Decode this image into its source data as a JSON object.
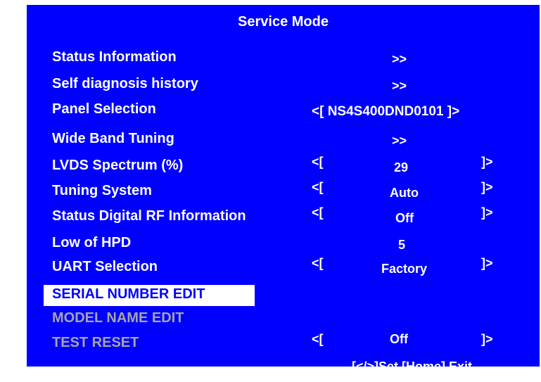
{
  "title": "Service Mode",
  "items": [
    {
      "label": "Status Information",
      "value": ">>"
    },
    {
      "label": "Self diagnosis history",
      "value": ">>"
    },
    {
      "label": "Panel Selection",
      "value": "<[ NS4S400DND0101 ]>"
    },
    {
      "label": "Wide Band Tuning",
      "value": ">>"
    },
    {
      "label": "LVDS Spectrum (%)",
      "bracket_left": "<[",
      "value": "29",
      "bracket_right": "]>"
    },
    {
      "label": "Tuning System",
      "bracket_left": "<[",
      "value": "Auto",
      "bracket_right": "]>"
    },
    {
      "label": "Status Digital RF Information",
      "bracket_left": "<[",
      "value": "Off",
      "bracket_right": "]>"
    },
    {
      "label": "Low of HPD",
      "value": "5"
    },
    {
      "label": "UART Selection",
      "bracket_left": "<[",
      "value": "Factory",
      "bracket_right": "]>"
    },
    {
      "label": "SERIAL NUMBER EDIT"
    },
    {
      "label": "MODEL NAME EDIT"
    },
    {
      "label": "TEST RESET",
      "bracket_left": "<[",
      "value": "Off",
      "bracket_right": "]>"
    }
  ],
  "footer": "[</>]Set [Home] Exit",
  "colors": {
    "panel_bg": "#0000ff",
    "text": "#ffffff",
    "selected_bg": "#ffffff",
    "selected_text": "#0000ff",
    "disabled_text": "#a6a6a6"
  }
}
